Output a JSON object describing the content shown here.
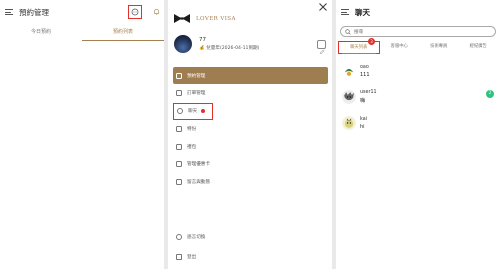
{
  "panel1": {
    "title": "預約管理",
    "tabs": [
      {
        "label": "今日預約",
        "active": false
      },
      {
        "label": "預約列表",
        "active": true
      }
    ],
    "icons": [
      "menu-icon",
      "chat-icon",
      "bell-icon"
    ]
  },
  "panel2": {
    "brand": "LOVER VISA",
    "user": {
      "name": "77",
      "sub": "💰 兌量年(2026-04-11到期)"
    },
    "menu": [
      {
        "label": "預約管理",
        "icon": "calendar-icon",
        "active": true
      },
      {
        "label": "訂單管理",
        "icon": "order-icon",
        "active": false
      },
      {
        "label": "聊天",
        "icon": "chat-icon",
        "active": false,
        "highlighted": true,
        "dot": true
      },
      {
        "label": "特份",
        "icon": "box-icon",
        "active": false
      },
      {
        "label": "禮包",
        "icon": "gift-icon",
        "active": false
      },
      {
        "label": "管理優惠卡",
        "icon": "card-icon",
        "active": false
      },
      {
        "label": "留言與動態",
        "icon": "comment-icon",
        "active": false
      }
    ],
    "bottom": [
      {
        "label": "語言切換",
        "icon": "globe-icon"
      },
      {
        "label": "登出",
        "icon": "logout-icon"
      }
    ]
  },
  "panel3": {
    "title": "聊天",
    "search_placeholder": "搜尋",
    "tabs": [
      {
        "label": "聊天列表",
        "active": true,
        "badge": "3"
      },
      {
        "label": "客服中心",
        "active": false
      },
      {
        "label": "技術專員",
        "active": false
      },
      {
        "label": "經紀廣告",
        "active": false
      }
    ],
    "conversations": [
      {
        "name": "oao",
        "message": "111",
        "unread": ""
      },
      {
        "name": "user11",
        "message": "嗨",
        "unread": "2"
      },
      {
        "name": "kai",
        "message": "hi",
        "unread": ""
      }
    ]
  },
  "colors": {
    "accent": "#a4804e",
    "active_menu": "#9e7e50",
    "highlight": "#e0312b",
    "unread": "#2ec27e"
  }
}
